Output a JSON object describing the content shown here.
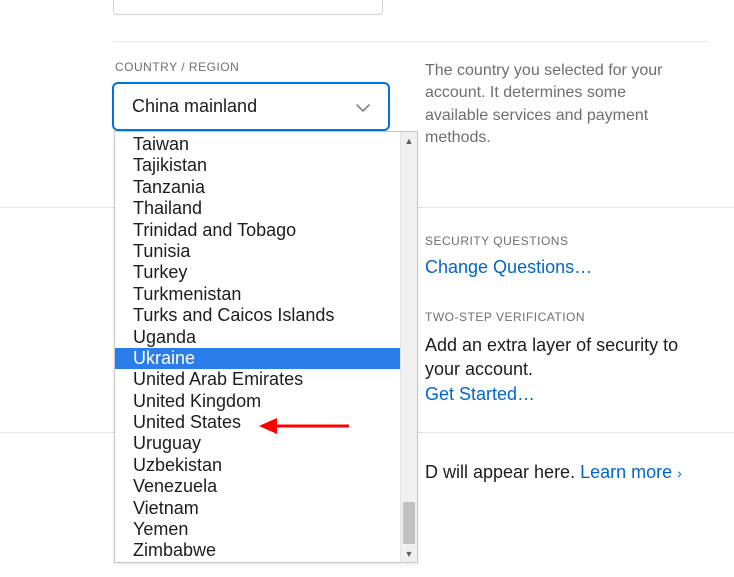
{
  "country_section": {
    "label": "COUNTRY / REGION",
    "selected": "China mainland",
    "help": "The country you selected for your account. It determines some available services and payment methods.",
    "options": [
      {
        "label": "Taiwan",
        "highlighted": false
      },
      {
        "label": "Tajikistan",
        "highlighted": false
      },
      {
        "label": "Tanzania",
        "highlighted": false
      },
      {
        "label": "Thailand",
        "highlighted": false
      },
      {
        "label": "Trinidad and Tobago",
        "highlighted": false
      },
      {
        "label": "Tunisia",
        "highlighted": false
      },
      {
        "label": "Turkey",
        "highlighted": false
      },
      {
        "label": "Turkmenistan",
        "highlighted": false
      },
      {
        "label": "Turks and Caicos Islands",
        "highlighted": false
      },
      {
        "label": "Uganda",
        "highlighted": false
      },
      {
        "label": "Ukraine",
        "highlighted": true
      },
      {
        "label": "United Arab Emirates",
        "highlighted": false
      },
      {
        "label": "United Kingdom",
        "highlighted": false
      },
      {
        "label": "United States",
        "highlighted": false
      },
      {
        "label": "Uruguay",
        "highlighted": false
      },
      {
        "label": "Uzbekistan",
        "highlighted": false
      },
      {
        "label": "Venezuela",
        "highlighted": false
      },
      {
        "label": "Vietnam",
        "highlighted": false
      },
      {
        "label": "Yemen",
        "highlighted": false
      },
      {
        "label": "Zimbabwe",
        "highlighted": false
      }
    ]
  },
  "security_questions": {
    "label": "SECURITY QUESTIONS",
    "link": "Change Questions…"
  },
  "two_step": {
    "label": "TWO-STEP VERIFICATION",
    "desc": "Add an extra layer of security to your account.",
    "link": "Get Started…"
  },
  "footer": {
    "text_suffix": "D will appear here. ",
    "learn_more": "Learn more"
  },
  "annotation": {
    "arrow_target": "United States"
  }
}
